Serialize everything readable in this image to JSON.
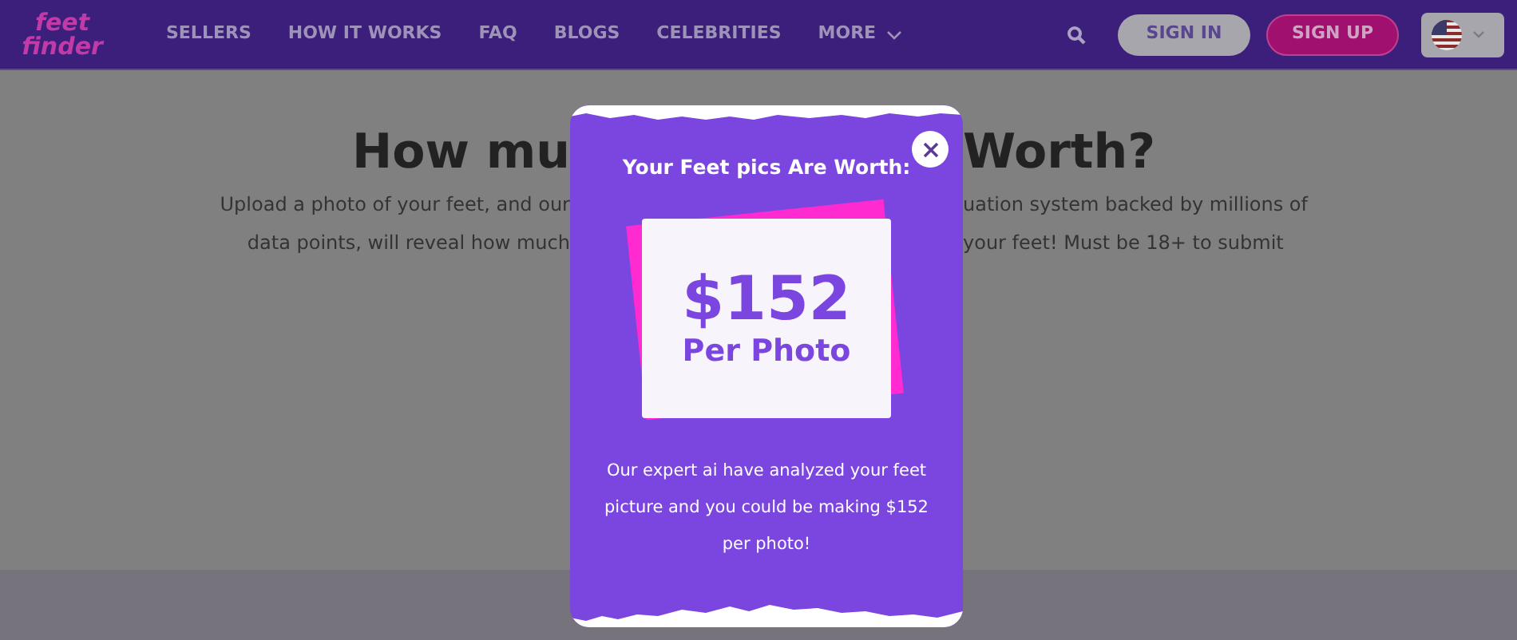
{
  "nav": {
    "logo": [
      "feet",
      "finder"
    ],
    "items": [
      {
        "label": "SELLERS",
        "has_caret": false
      },
      {
        "label": "HOW IT WORKS",
        "has_caret": false
      },
      {
        "label": "FAQ",
        "has_caret": false
      },
      {
        "label": "BLOGS",
        "has_caret": false
      },
      {
        "label": "CELEBRITIES",
        "has_caret": false
      },
      {
        "label": "MORE",
        "has_caret": true
      }
    ],
    "buttons": [
      {
        "kind": "outline",
        "label": "SIGN IN"
      },
      {
        "kind": "primary",
        "label": "SIGN UP"
      }
    ]
  },
  "hero": {
    "title_left": "How mu",
    "title_right": "Worth?",
    "lines": [
      {
        "left": "Upload a photo of your feet, and our",
        "right": "uation system backed by millions of"
      },
      {
        "left": "data points, will reveal how much",
        "right": "your feet! Must be 18+ to submit"
      }
    ]
  },
  "modal": {
    "title": "Your Feet pics Are Worth:",
    "amount": "$152",
    "unit": "Per Photo",
    "message": "Our expert ai have analyzed your feet picture and you could be making $152 per photo!"
  }
}
